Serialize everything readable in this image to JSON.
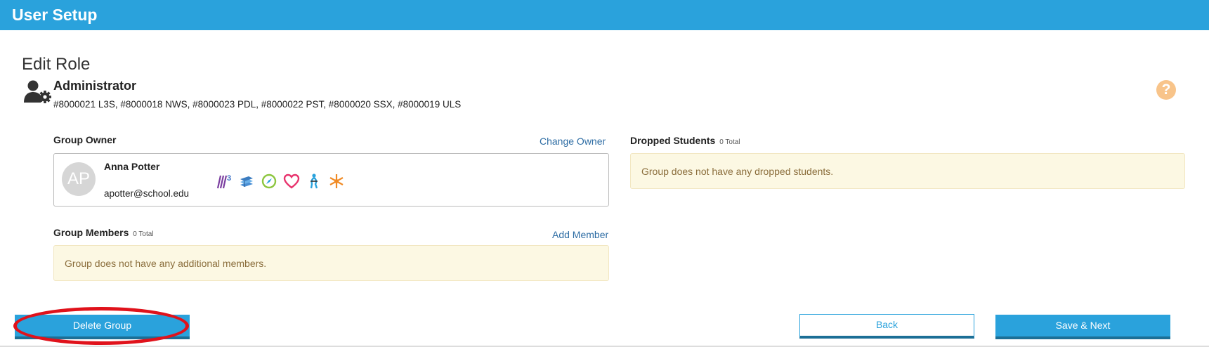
{
  "header": {
    "title": "User Setup"
  },
  "page": {
    "heading": "Edit Role"
  },
  "role": {
    "name": "Administrator",
    "groups": "#8000021 L3S, #8000018 NWS, #8000023 PDL, #8000022 PST, #8000020 SSX, #8000019 ULS",
    "icon": "user-gear-icon"
  },
  "help": {
    "icon": "help-icon",
    "glyph": "?"
  },
  "owner": {
    "label": "Group Owner",
    "change_link": "Change Owner",
    "avatar_initials": "AP",
    "name": "Anna Potter",
    "email": "apotter@school.edu",
    "product_icons": [
      "l3-icon",
      "books-icon",
      "compass-icon",
      "heart-icon",
      "figure-icon",
      "snowflake-icon"
    ]
  },
  "members": {
    "label": "Group Members",
    "total": "0 Total",
    "add_link": "Add Member",
    "empty_message": "Group does not have any additional members."
  },
  "dropped": {
    "label": "Dropped Students",
    "total": "0 Total",
    "empty_message": "Group does not have any dropped students."
  },
  "actions": {
    "delete_label": "Delete Group",
    "back_label": "Back",
    "save_label": "Save & Next"
  },
  "colors": {
    "header_blue": "#2aa2dc",
    "link_blue": "#2e6da4",
    "notice_bg": "#fcf8e3",
    "highlight_red": "#e0121b",
    "help_orange": "#f8c48a"
  }
}
